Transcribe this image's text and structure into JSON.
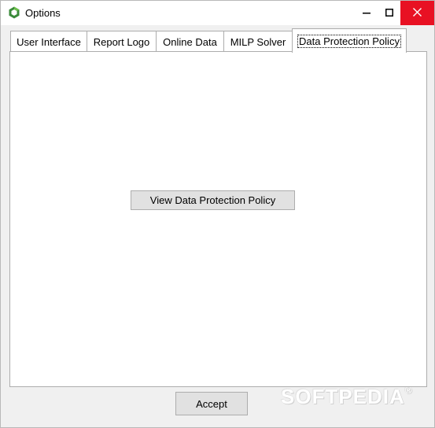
{
  "window": {
    "title": "Options"
  },
  "tabs": [
    {
      "label": "User Interface",
      "active": false
    },
    {
      "label": "Report Logo",
      "active": false
    },
    {
      "label": "Online Data",
      "active": false
    },
    {
      "label": "MILP Solver",
      "active": false
    },
    {
      "label": "Data Protection Policy",
      "active": true
    }
  ],
  "panel": {
    "view_policy_button": "View Data Protection Policy"
  },
  "footer": {
    "accept_button": "Accept"
  },
  "watermark": {
    "text": "SOFTPEDIA",
    "mark": "®"
  },
  "colors": {
    "close_button": "#e81123",
    "app_icon_green": "#3a8a3a",
    "button_face": "#e1e1e1"
  },
  "icons": {
    "app": "hexagon-ring-icon",
    "minimize": "minimize-icon",
    "maximize": "maximize-icon",
    "close": "close-icon"
  }
}
